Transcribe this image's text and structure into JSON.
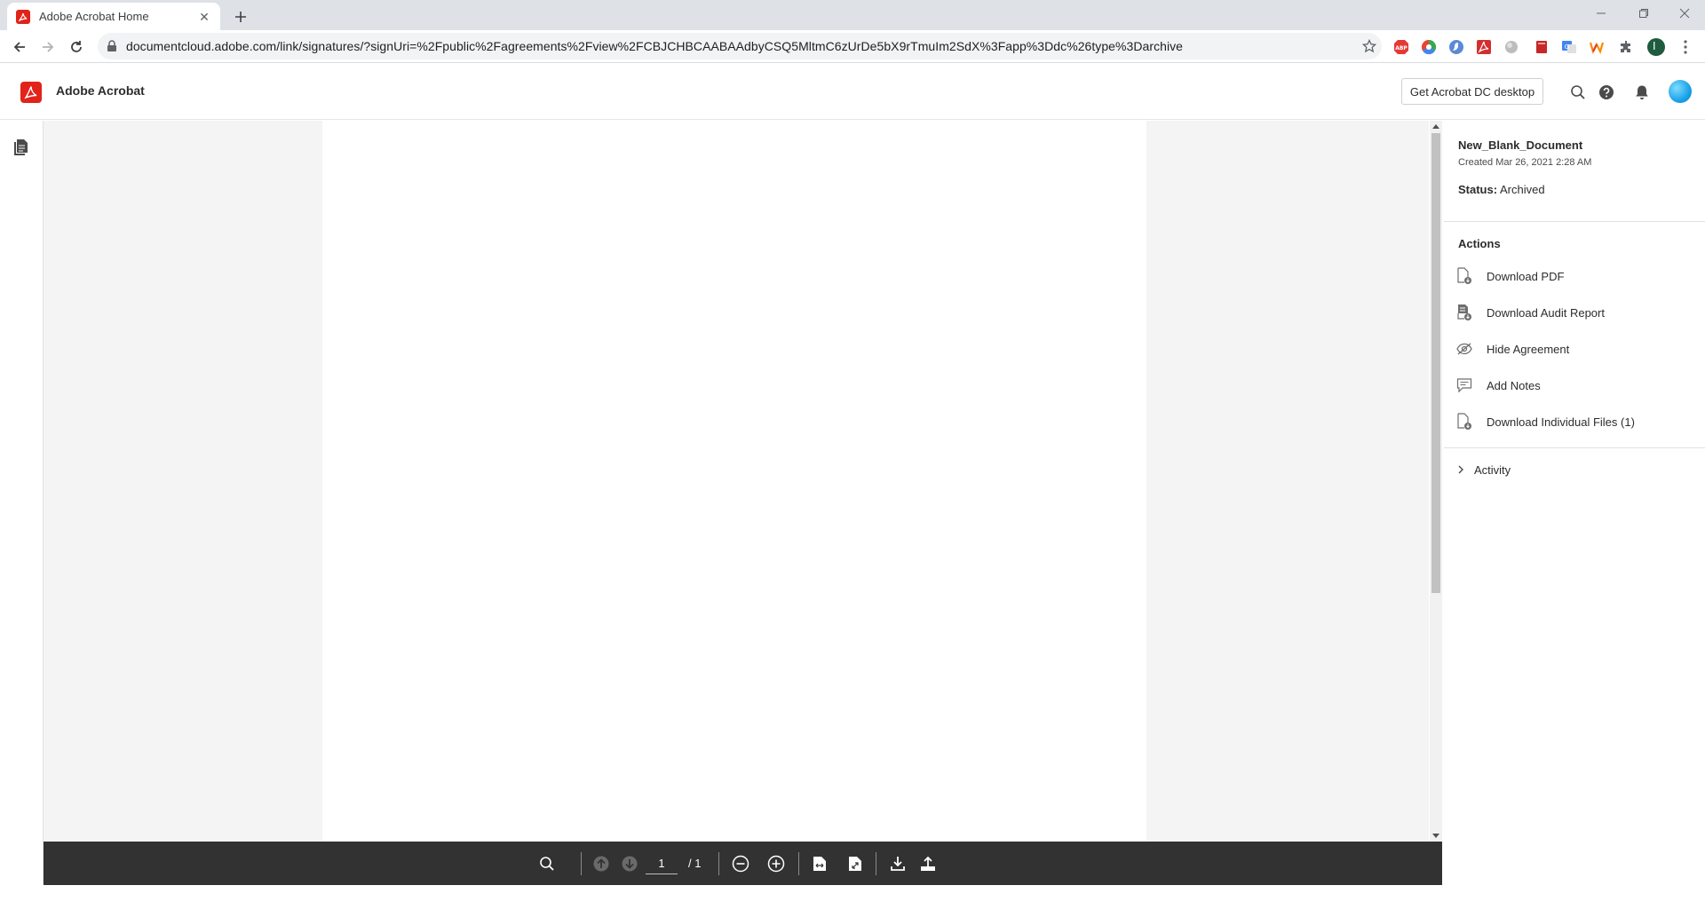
{
  "browser": {
    "tab_title": "Adobe Acrobat Home",
    "url": "documentcloud.adobe.com/link/signatures/?signUri=%2Fpublic%2Fagreements%2Fview%2FCBJCHBCAABAAdbyCSQ5MltmC6zUrDe5bX9rTmuIm2SdX%3Fapp%3Ddc%26type%3Darchive",
    "profile_initial": "I"
  },
  "app": {
    "name": "Adobe Acrobat",
    "get_desktop_label": "Get Acrobat DC desktop",
    "brand_color": "#e2231a"
  },
  "viewer": {
    "page_current": "1",
    "page_total": "/ 1"
  },
  "panel": {
    "doc_name": "New_Blank_Document",
    "created": "Created Mar 26, 2021 2:28 AM",
    "status_label": "Status:",
    "status_value": "Archived",
    "actions_heading": "Actions",
    "actions": [
      {
        "label": "Download PDF",
        "icon": "download-pdf-icon"
      },
      {
        "label": "Download Audit Report",
        "icon": "audit-report-icon"
      },
      {
        "label": "Hide Agreement",
        "icon": "hide-eye-icon"
      },
      {
        "label": "Add Notes",
        "icon": "notes-icon"
      },
      {
        "label": "Download Individual Files (1)",
        "icon": "download-files-icon"
      }
    ],
    "activity_label": "Activity"
  }
}
